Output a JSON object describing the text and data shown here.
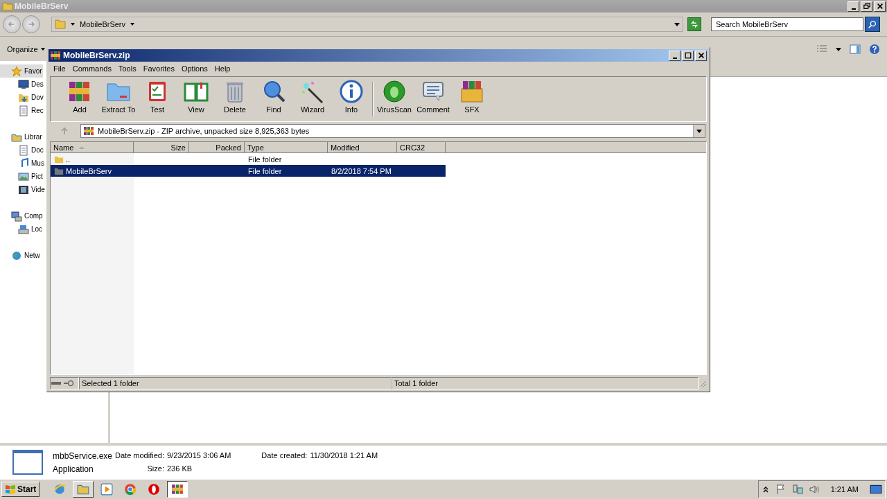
{
  "explorer": {
    "title": "MobileBrServ",
    "address": "MobileBrServ",
    "search": {
      "placeholder": "Search MobileBrServ"
    },
    "organize": "Organize",
    "sidebar": [
      {
        "label": "Favor",
        "kind": "star",
        "selected": true,
        "children": [
          {
            "label": "Des",
            "kind": "desktop"
          },
          {
            "label": "Dov",
            "kind": "download"
          },
          {
            "label": "Rec",
            "kind": "recent"
          }
        ]
      },
      {
        "label": "Librar",
        "kind": "library",
        "selected": false,
        "children": [
          {
            "label": "Doc",
            "kind": "document"
          },
          {
            "label": "Mus",
            "kind": "music"
          },
          {
            "label": "Pict",
            "kind": "picture"
          },
          {
            "label": "Vide",
            "kind": "video"
          }
        ]
      },
      {
        "label": "Comp",
        "kind": "computer",
        "selected": false,
        "children": [
          {
            "label": "Loc",
            "kind": "disk"
          }
        ]
      },
      {
        "label": "Netw",
        "kind": "network",
        "selected": false
      }
    ],
    "details": {
      "name": "mbbService.exe",
      "type": "Application",
      "fields": [
        {
          "label": "Date modified:",
          "value": "9/23/2015 3:06 AM"
        },
        {
          "label": "Size:",
          "value": "236 KB"
        },
        {
          "label": "Date created:",
          "value": "11/30/2018 1:21 AM"
        }
      ]
    }
  },
  "winrar": {
    "title": "MobileBrServ.zip",
    "menu": [
      "File",
      "Commands",
      "Tools",
      "Favorites",
      "Options",
      "Help"
    ],
    "tools": [
      {
        "label": "Add",
        "kind": "add"
      },
      {
        "label": "Extract To",
        "kind": "extract"
      },
      {
        "label": "Test",
        "kind": "test"
      },
      {
        "label": "View",
        "kind": "view"
      },
      {
        "label": "Delete",
        "kind": "delete"
      },
      {
        "label": "Find",
        "kind": "find"
      },
      {
        "label": "Wizard",
        "kind": "wizard"
      },
      {
        "label": "Info",
        "kind": "info"
      },
      {
        "label": "VirusScan",
        "kind": "virus"
      },
      {
        "label": "Comment",
        "kind": "comment"
      },
      {
        "label": "SFX",
        "kind": "sfx"
      }
    ],
    "path": "MobileBrServ.zip - ZIP archive, unpacked size 8,925,363 bytes",
    "columns": [
      {
        "label": "Name",
        "sorted": true
      },
      {
        "label": "Size",
        "sorted": false
      },
      {
        "label": "Packed",
        "sorted": false
      },
      {
        "label": "Type",
        "sorted": false
      },
      {
        "label": "Modified",
        "sorted": false
      },
      {
        "label": "CRC32",
        "sorted": false
      }
    ],
    "rows": [
      {
        "name": "..",
        "kind": "up",
        "type": "File folder",
        "selected": false
      },
      {
        "name": "MobileBrServ",
        "kind": "folder",
        "type": "File folder",
        "modified": "8/2/2018 7:54 PM",
        "selected": true
      }
    ],
    "status": {
      "left": "Selected 1 folder",
      "right": "Total 1 folder"
    }
  },
  "taskbar": {
    "start": "Start",
    "apps": [
      {
        "kind": "browser",
        "selected": false
      },
      {
        "kind": "explorer",
        "selected": true
      },
      {
        "kind": "media",
        "selected": false
      },
      {
        "kind": "chrome",
        "selected": false
      },
      {
        "kind": "opera",
        "selected": false
      },
      {
        "kind": "archive",
        "selected": true
      }
    ],
    "time": "1:21 AM"
  }
}
